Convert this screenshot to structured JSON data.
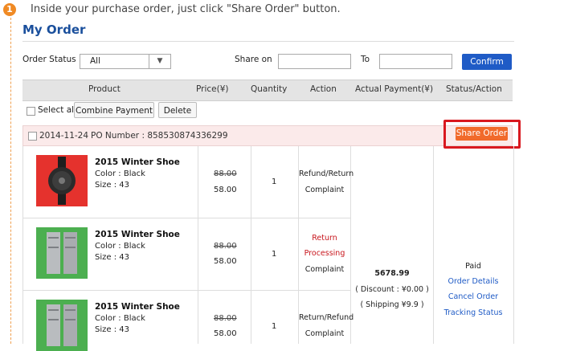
{
  "step": {
    "number": "1",
    "instruction": "Inside your purchase order, just click \"Share Order\" button."
  },
  "page_title": "My Order",
  "filters": {
    "status_label": "Order Status",
    "status_value": "All",
    "share_on_label": "Share on",
    "to_label": "To",
    "confirm_label": "Confirm"
  },
  "table_headers": [
    "Product",
    "Price(¥)",
    "Quantity",
    "Action",
    "Actual Payment(¥)",
    "Status/Action"
  ],
  "bulk": {
    "select_all": "Select all",
    "combine_payment": "Combine Payment",
    "delete": "Delete"
  },
  "order": {
    "date": "2014-11-24",
    "po_number": "PO Number : 858530874336299",
    "share_label": "Share Order",
    "items": [
      {
        "name": "2015 Winter Shoe",
        "color": "Color : Black",
        "size": "Size : 43",
        "price_old": "88.00",
        "price_new": "58.00",
        "qty": "1",
        "actions": [
          "Refund/Return",
          "Complaint"
        ],
        "image": "black smartwatch on red background"
      },
      {
        "name": "2015 Winter Shoe",
        "color": "Color : Black",
        "size": "Size : 43",
        "price_old": "88.00",
        "price_new": "58.00",
        "qty": "1",
        "actions": [
          "Return",
          "Processing",
          "Complaint"
        ],
        "image": "grey rack units on green background"
      },
      {
        "name": "2015 Winter Shoe",
        "color": "Color : Black",
        "size": "Size : 43",
        "price_old": "88.00",
        "price_new": "58.00",
        "qty": "1",
        "actions": [
          "Return/Refund",
          "Complaint"
        ],
        "image": "grey rack units on green background"
      }
    ],
    "payment": {
      "total": "5678.99",
      "discount": "( Discount : ¥0.00 )",
      "shipping": "( Shipping ¥9.9 )"
    },
    "status": {
      "state": "Paid",
      "links": [
        "Order Details",
        "Cancel Order",
        "Tracking Status"
      ]
    }
  },
  "colors": {
    "accent_blue": "#1f5bc6",
    "share_orange": "#f16a2b",
    "highlight_red": "#d9181f",
    "step_orange": "#f08a24"
  }
}
